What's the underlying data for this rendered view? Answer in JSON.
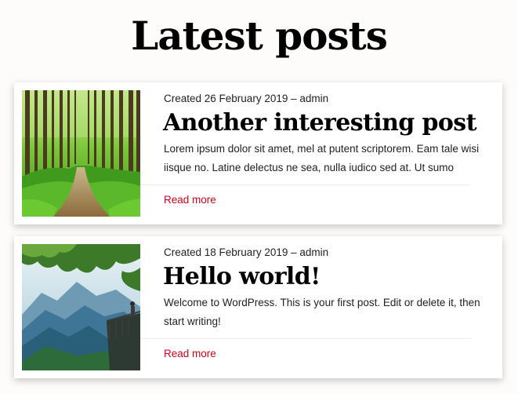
{
  "page": {
    "title": "Latest posts"
  },
  "posts": [
    {
      "meta": "Created 26 February 2019 – admin",
      "title": "Another interesting post",
      "excerpt": "Lorem ipsum dolor sit amet, mel at putent scriptorem. Eam tale wisi iisque no. Latine delectus ne sea, nulla iudico sed at. Ut sumo",
      "read_more": "Read more",
      "thumbnail": "forest-path-image"
    },
    {
      "meta": "Created 18 February 2019 – admin",
      "title": "Hello world!",
      "excerpt": "Welcome to WordPress. This is your first post. Edit or delete it, then start writing!",
      "read_more": "Read more",
      "thumbnail": "mountain-valley-image"
    }
  ],
  "colors": {
    "background": "#fdfcfa",
    "card": "#ffffff",
    "link": "#d0021b",
    "text": "#222222"
  }
}
